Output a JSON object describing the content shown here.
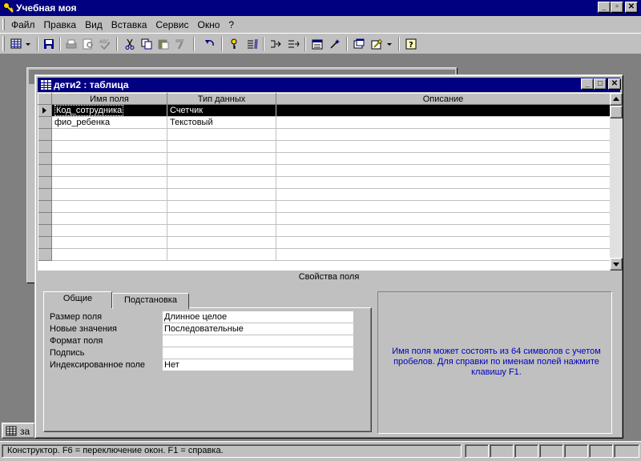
{
  "app": {
    "title": "Учебная моя"
  },
  "menu": [
    "Файл",
    "Правка",
    "Вид",
    "Вставка",
    "Сервис",
    "Окно",
    "?"
  ],
  "mdi": {
    "minimized_label": "за"
  },
  "table_window": {
    "title": "дети2 : таблица",
    "columns": [
      "Имя поля",
      "Тип данных",
      "Описание"
    ],
    "rows": [
      {
        "field": "Код_сотрудника",
        "type": "Счетчик",
        "desc": ""
      },
      {
        "field": "фио_ребенка",
        "type": "Текстовый",
        "desc": ""
      }
    ],
    "props_label": "Свойства поля",
    "tabs": [
      "Общие",
      "Подстановка"
    ],
    "properties": [
      {
        "label": "Размер поля",
        "value": "Длинное целое"
      },
      {
        "label": "Новые значения",
        "value": "Последовательные"
      },
      {
        "label": "Формат поля",
        "value": ""
      },
      {
        "label": "Подпись",
        "value": ""
      },
      {
        "label": "Индексированное поле",
        "value": "Нет"
      }
    ],
    "help_text": "Имя поля может состоять из 64 символов с учетом пробелов.  Для справки по именам полей нажмите клавишу F1."
  },
  "status": {
    "text": "Конструктор.  F6 = переключение окон.  F1 = справка."
  },
  "colors": {
    "titlebar": "#000080",
    "face": "#c0c0c0",
    "help_text": "#0000c0",
    "mdi_bg": "#808080"
  },
  "icons": {
    "toolbar": [
      "view-icon",
      "save-icon",
      "print-icon",
      "print-preview-icon",
      "spelling-icon",
      "cut-icon",
      "copy-icon",
      "paste-icon",
      "format-painter-icon",
      "undo-icon",
      "primary-key-icon",
      "indexes-icon",
      "insert-rows-icon",
      "delete-rows-icon",
      "properties-icon",
      "build-icon",
      "database-window-icon",
      "new-object-icon",
      "help-icon"
    ]
  }
}
